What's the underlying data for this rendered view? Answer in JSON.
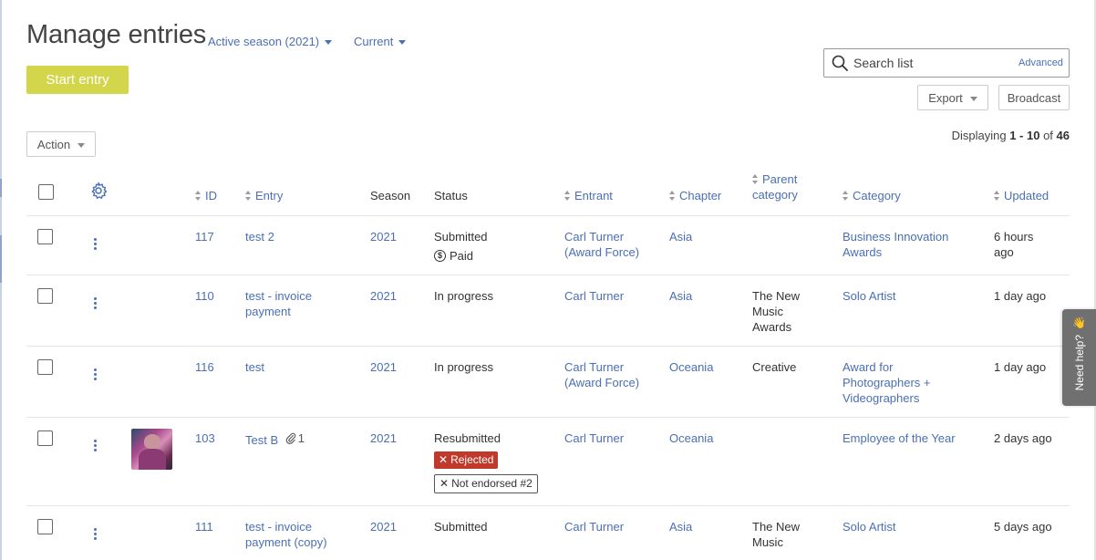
{
  "page": {
    "title": "Manage entries",
    "season_filter": "Active season (2021)",
    "status_filter": "Current",
    "start_entry_label": "Start entry"
  },
  "search": {
    "placeholder": "Search list",
    "advanced_label": "Advanced"
  },
  "toolbar": {
    "export_label": "Export",
    "broadcast_label": "Broadcast",
    "action_label": "Action"
  },
  "pagination": {
    "prefix": "Displaying",
    "range": "1 - 10",
    "of": "of",
    "total": "46"
  },
  "table": {
    "columns": {
      "id": "ID",
      "entry": "Entry",
      "season": "Season",
      "status": "Status",
      "entrant": "Entrant",
      "chapter": "Chapter",
      "parent_category_1": "Parent",
      "parent_category_2": "category",
      "category": "Category",
      "updated": "Updated"
    },
    "rows": [
      {
        "id": "117",
        "entry": "test 2",
        "season": "2021",
        "status": "Submitted",
        "paid": "Paid",
        "entrant_1": "Carl Turner",
        "entrant_2": "(Award Force)",
        "chapter": "Asia",
        "parent_category": "",
        "category_1": "Business Innovation",
        "category_2": "Awards",
        "updated_1": "6 hours",
        "updated_2": "ago"
      },
      {
        "id": "110",
        "entry_1": "test - invoice",
        "entry_2": "payment",
        "season": "2021",
        "status": "In progress",
        "entrant": "Carl Turner",
        "chapter": "Asia",
        "parent_1": "The New",
        "parent_2": "Music",
        "parent_3": "Awards",
        "category": "Solo Artist",
        "updated": "1 day ago"
      },
      {
        "id": "116",
        "entry": "test",
        "season": "2021",
        "status": "In progress",
        "entrant_1": "Carl Turner",
        "entrant_2": "(Award Force)",
        "chapter": "Oceania",
        "parent": "Creative",
        "category_1": "Award for",
        "category_2": "Photographers +",
        "category_3": "Videographers",
        "updated": "1 day ago"
      },
      {
        "id": "103",
        "entry": "Test B",
        "attachments": "1",
        "season": "2021",
        "status": "Resubmitted",
        "badge_rejected": "Rejected",
        "badge_not_endorsed": "Not endorsed #2",
        "entrant": "Carl Turner",
        "chapter": "Oceania",
        "category": "Employee of the Year",
        "updated": "2 days ago"
      },
      {
        "id": "111",
        "entry_1": "test - invoice",
        "entry_2": "payment (copy)",
        "season": "2021",
        "status": "Submitted",
        "entrant": "Carl Turner",
        "chapter": "Asia",
        "parent_1": "The New",
        "parent_2": "Music",
        "category": "Solo Artist",
        "updated": "5 days ago"
      }
    ]
  },
  "help": {
    "label": "Need help?",
    "icon": "waving-hand-icon"
  },
  "colors": {
    "link": "#4a6fb5",
    "start_button": "#d3d64a",
    "rejected": "#c0392b"
  }
}
